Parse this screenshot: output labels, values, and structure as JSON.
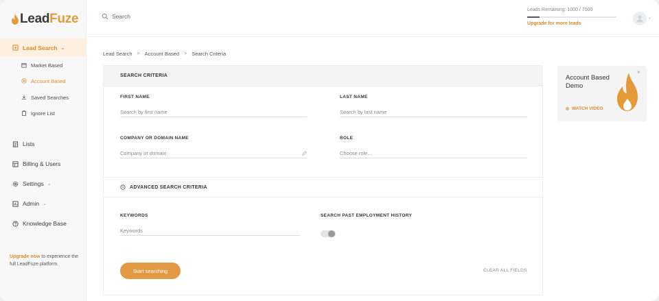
{
  "brand": {
    "lead": "Lead",
    "fuze": "Fuze",
    "accent": "#e59a3a"
  },
  "sidebar": {
    "active": {
      "label": "Lead Search",
      "icon": "filter-icon"
    },
    "sub_items": [
      {
        "label": "Market Based",
        "icon": "building-icon"
      },
      {
        "label": "Account Based",
        "icon": "target-icon",
        "active": true
      },
      {
        "label": "Saved Searches",
        "icon": "download-icon"
      },
      {
        "label": "Ignore List",
        "icon": "clipboard-icon"
      }
    ],
    "items": [
      {
        "label": "Lists",
        "icon": "list-icon"
      },
      {
        "label": "Billing & Users",
        "icon": "billing-icon"
      },
      {
        "label": "Settings",
        "icon": "gear-icon"
      },
      {
        "label": "Admin",
        "icon": "admin-icon"
      },
      {
        "label": "Knowledge Base",
        "icon": "help-icon"
      }
    ],
    "upgrade": {
      "link": "Upgrade now",
      "text": " to experience the full LeadFuze platform."
    }
  },
  "topbar": {
    "search_placeholder": "Search",
    "leads_label": "Leads Remaining: 1000 / 7000",
    "leads_fraction": 0.14,
    "upgrade_link": "Upgrade for more leads"
  },
  "breadcrumb": [
    "Lead Search",
    "Account Based",
    "Search Criteria"
  ],
  "form": {
    "header": "SEARCH CRITERIA",
    "first_name": {
      "label": "FIRST NAME",
      "placeholder": "Search by first name"
    },
    "last_name": {
      "label": "LAST NAME",
      "placeholder": "Search by last name"
    },
    "company": {
      "label": "COMPANY OR DOMAIN NAME",
      "placeholder": "Company or domain"
    },
    "role": {
      "label": "ROLE",
      "placeholder": "Choose role..."
    },
    "advanced": "ADVANCED SEARCH CRITERIA",
    "keywords": {
      "label": "KEYWORDS",
      "placeholder": "Keywords"
    },
    "past_employment": {
      "label": "SEARCH PAST EMPLOYMENT HISTORY",
      "enabled": false
    },
    "start_button": "Start searching",
    "clear_button": "CLEAR ALL FIELDS"
  },
  "demo": {
    "title": "Account Based Demo",
    "watch": "WATCH VIDEO",
    "close": "×"
  }
}
